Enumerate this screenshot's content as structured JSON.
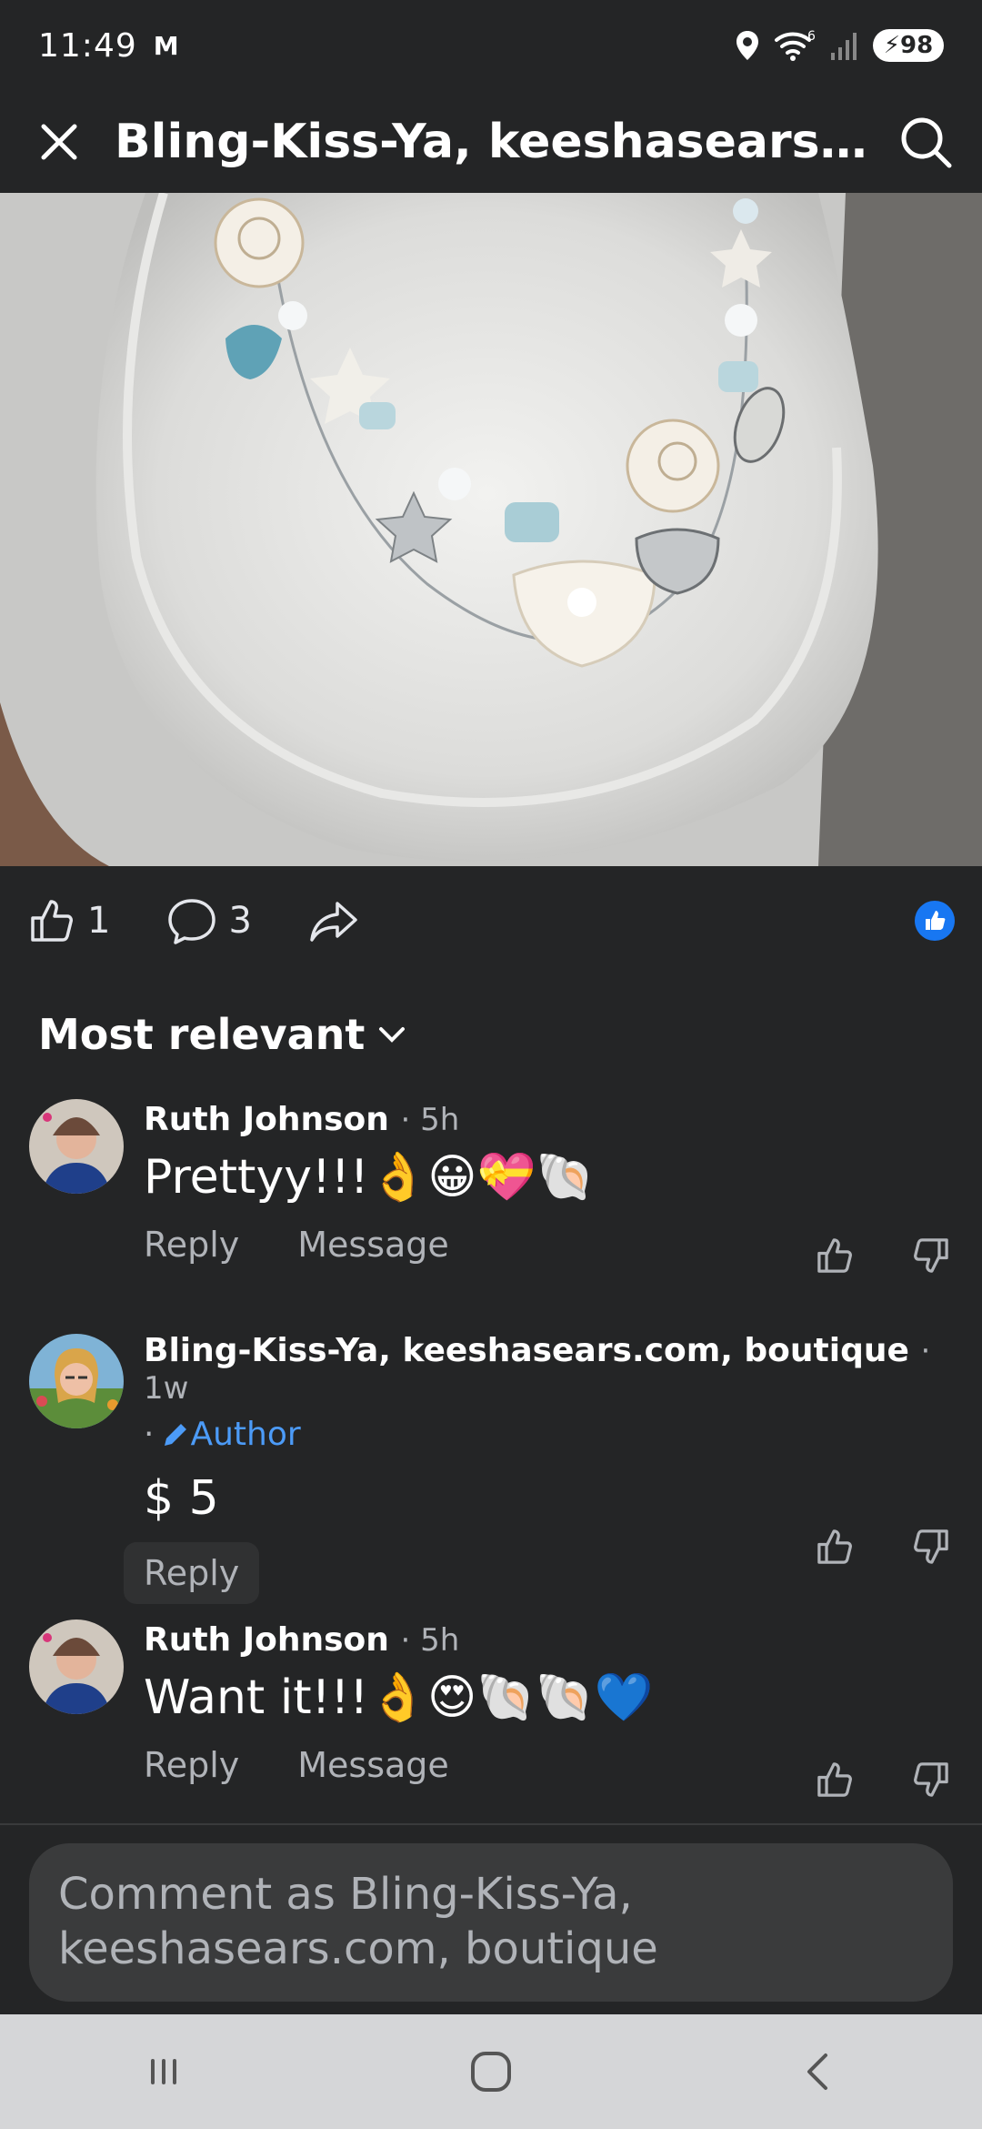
{
  "status": {
    "time": "11:49",
    "carrier_icon": "M",
    "network": "6",
    "battery": "98"
  },
  "header": {
    "title": "Bling-Kiss-Ya, keeshasears.com,..."
  },
  "post": {
    "likes": "1",
    "comments": "3",
    "accent": "#1877f2"
  },
  "sort": {
    "label": "Most relevant"
  },
  "comments": [
    {
      "name": "Ruth Johnson",
      "time": "· 5h",
      "text": "Prettyy!!!👌😀💝🐚",
      "reply": "Reply",
      "message": "Message"
    },
    {
      "name": "Bling-Kiss-Ya, keeshasears.com, boutique",
      "time": "· 1w",
      "dot": "·",
      "tag": "Author",
      "text": "$ 5",
      "reply": "Reply"
    },
    {
      "name": "Ruth Johnson",
      "time": "· 5h",
      "text": "Want it!!!👌😍🐚🐚💙",
      "reply": "Reply",
      "message": "Message"
    }
  ],
  "composer": {
    "placeholder": "Comment as Bling-Kiss-Ya, keeshasears.com, boutique"
  }
}
